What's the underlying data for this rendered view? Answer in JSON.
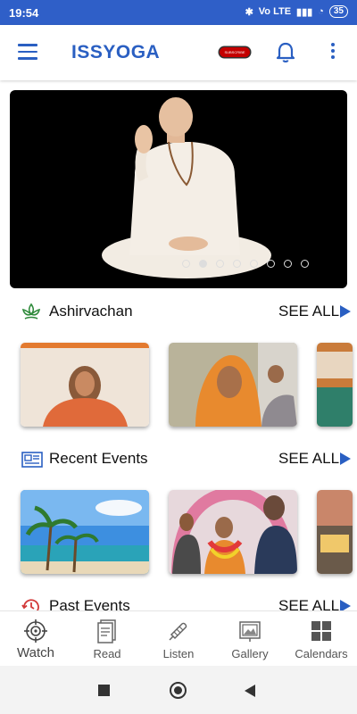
{
  "status_bar": {
    "time": "19:54",
    "signal_text": "Vo LTE",
    "battery": "35"
  },
  "app_bar": {
    "title": "ISSYOGA",
    "subscribe_badge": "SUBSCRIBE"
  },
  "carousel": {
    "slides": 8,
    "active_slide": 2
  },
  "sections": [
    {
      "title": "Ashirvachan",
      "see_all": "SEE ALL",
      "icon": "lotus-icon"
    },
    {
      "title": "Recent Events",
      "see_all": "SEE ALL",
      "icon": "newspaper-icon"
    },
    {
      "title": "Past Events",
      "see_all": "SEE ALL",
      "icon": "history-clock-icon"
    }
  ],
  "bottom_nav": [
    {
      "label": "Watch",
      "icon": "target-icon"
    },
    {
      "label": "Read",
      "icon": "book-icon"
    },
    {
      "label": "Listen",
      "icon": "mic-icon"
    },
    {
      "label": "Gallery",
      "icon": "gallery-icon"
    },
    {
      "label": "Calendars",
      "icon": "grid-icon"
    }
  ],
  "colors": {
    "accent": "#2a5fc2",
    "status_bar": "#2f5fc8",
    "subscribe": "#c40000"
  }
}
